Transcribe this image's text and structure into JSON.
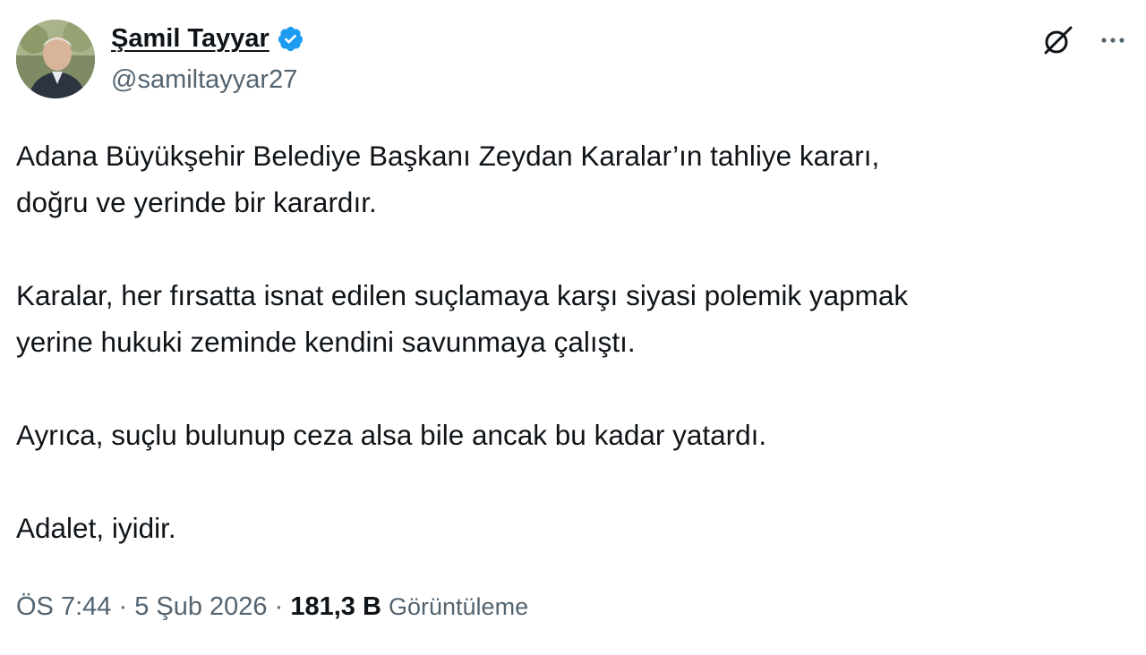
{
  "author": {
    "display_name": "Şamil Tayyar",
    "handle": "@samiltayyar27",
    "verified": true,
    "avatar_icon": "profile-photo"
  },
  "actions": {
    "grok_icon": "grok-icon",
    "more_icon": "more-options-icon"
  },
  "tweet": {
    "paragraphs": [
      "Adana Büyükşehir Belediye Başkanı Zeydan Karalar’ın tahliye kararı,\ndoğru ve yerinde bir karardır.",
      "Karalar, her fırsatta isnat edilen suçlamaya karşı siyasi polemik yapmak\nyerine hukuki zeminde kendini savunmaya çalıştı.",
      "Ayrıca, suçlu bulunup ceza alsa bile ancak bu kadar yatardı.",
      "Adalet, iyidir."
    ]
  },
  "meta": {
    "time": "ÖS 7:44",
    "separator": "·",
    "date": "5 Şub 2026",
    "views_count": "181,3 B",
    "views_label": "Görüntüleme"
  },
  "colors": {
    "text_primary": "#0f1419",
    "text_secondary": "#536471",
    "verified_blue": "#1d9bf0"
  }
}
